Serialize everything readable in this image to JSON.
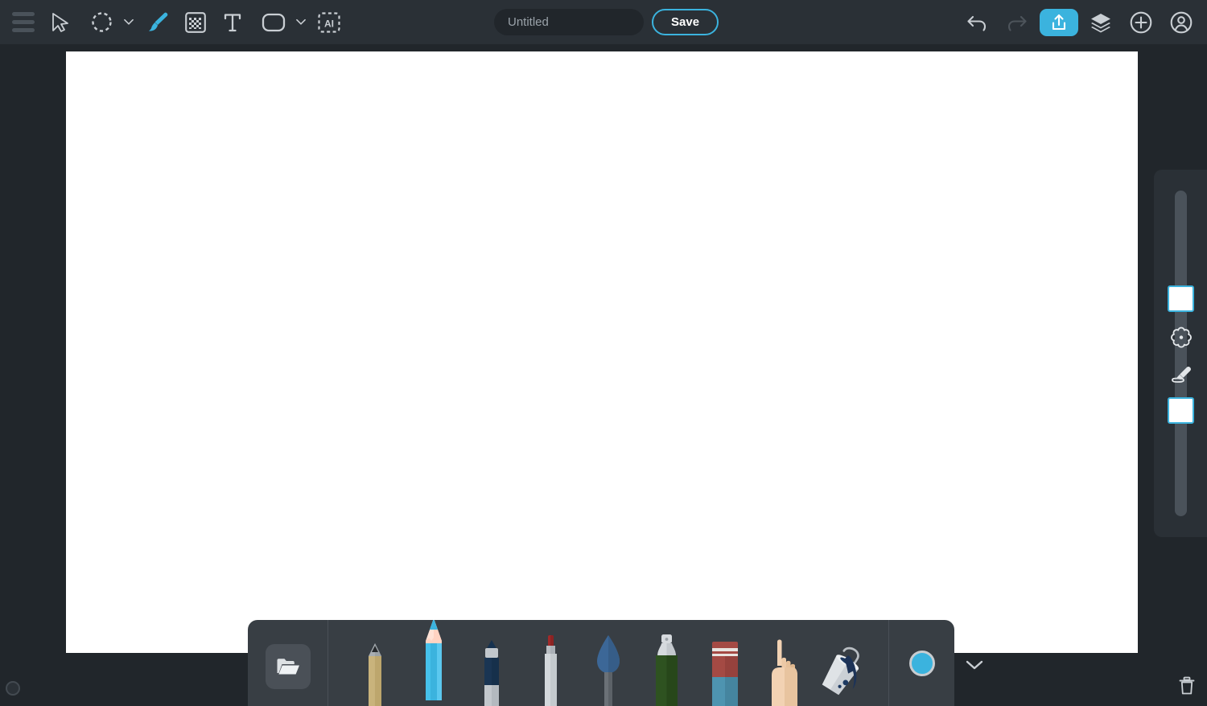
{
  "app": {
    "background_color": "#21262b",
    "topbar_color": "#2a3036",
    "accent_color": "#3bb3de",
    "canvas_color": "#ffffff",
    "dock_color": "#383e44"
  },
  "topbar": {
    "menu_label": "menu",
    "tools": [
      {
        "name": "select-pointer-tool",
        "label": "Select",
        "active": false
      },
      {
        "name": "marquee-selection-tool",
        "label": "Selection",
        "active": false,
        "has_dropdown": true
      },
      {
        "name": "brush-tool",
        "label": "Brush",
        "active": true
      },
      {
        "name": "pattern-tool",
        "label": "Pattern",
        "active": false
      },
      {
        "name": "text-tool",
        "label": "Text",
        "active": false
      },
      {
        "name": "shape-tool",
        "label": "Shape",
        "active": false,
        "has_dropdown": true
      },
      {
        "name": "ai-tool",
        "label": "AI",
        "active": false
      }
    ],
    "title_value": "",
    "title_placeholder": "Untitled",
    "save_label": "Save",
    "right_actions": [
      {
        "name": "undo-button",
        "label": "Undo",
        "enabled": true
      },
      {
        "name": "redo-button",
        "label": "Redo",
        "enabled": false
      },
      {
        "name": "share-button",
        "label": "Share",
        "highlighted": true
      },
      {
        "name": "layers-button",
        "label": "Layers"
      },
      {
        "name": "add-button",
        "label": "Add"
      },
      {
        "name": "account-button",
        "label": "Account"
      }
    ]
  },
  "right_panel": {
    "primary_color": "#ffffff",
    "secondary_color": "#ffffff",
    "palette_label": "Color palette",
    "eyedropper_label": "Eyedropper"
  },
  "dock": {
    "open_label": "Open",
    "active_color": "#3bb3de",
    "collapse_label": "Collapse",
    "tools": [
      {
        "name": "pencil-tool",
        "label": "Pencil",
        "selected": false
      },
      {
        "name": "colored-pencil-tool",
        "label": "Colored Pencil",
        "selected": true
      },
      {
        "name": "marker-tool",
        "label": "Marker",
        "selected": false
      },
      {
        "name": "pen-tool",
        "label": "Pen",
        "selected": false
      },
      {
        "name": "watercolor-brush-tool",
        "label": "Watercolor Brush",
        "selected": false
      },
      {
        "name": "spray-can-tool",
        "label": "Spray Can",
        "selected": false
      },
      {
        "name": "eraser-tool",
        "label": "Eraser",
        "selected": false
      },
      {
        "name": "smudge-tool",
        "label": "Smudge",
        "selected": false
      },
      {
        "name": "paint-bucket-tool",
        "label": "Paint Bucket",
        "selected": false
      }
    ]
  },
  "footer": {
    "brush_size_label": "Brush size",
    "trash_label": "Delete"
  }
}
